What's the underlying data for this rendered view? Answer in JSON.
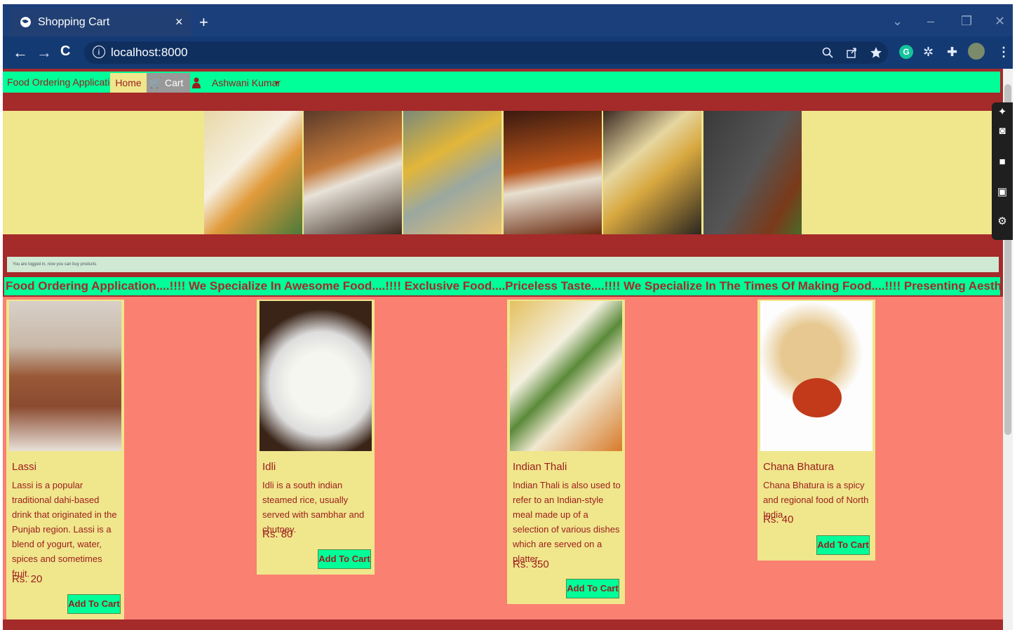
{
  "browser": {
    "tab_title": "Shopping Cart",
    "tab_close": "×",
    "new_tab": "+",
    "url": "localhost:8000",
    "window_controls": [
      "⌄",
      "–",
      "❐",
      "✕"
    ],
    "nav": {
      "back": "←",
      "forward": "→",
      "reload": "C"
    },
    "toolbar_icons": [
      "zoom-icon",
      "share-icon",
      "bookmark-star-icon",
      "grammarly-icon",
      "extension-icon",
      "puzzle-icon",
      "profile-avatar",
      "menu-icon"
    ]
  },
  "navbar": {
    "brand": "Food Ordering Application",
    "home": "Home",
    "cart": "Cart",
    "user": "Ashwani Kumar"
  },
  "alert": {
    "text": "You are logged in, now you can buy products"
  },
  "marquee": {
    "text": "Food Ordering Application....!!!! We Specialize In Awesome Food....!!!! Exclusive Food....Priceless Taste....!!!! We Specialize In The Times Of Making Food....!!!! Presenting Aesthetic Food....!!!! Count Memo"
  },
  "products": [
    {
      "name": "Lassi",
      "desc": "Lassi is a popular traditional dahi-based drink that originated in the Punjab region. Lassi is a blend of yogurt, water, spices and sometimes fruit.",
      "price": "Rs. 20",
      "button": "Add To Cart"
    },
    {
      "name": "Idli",
      "desc": "Idli is a south indian steamed rice, usually served with sambhar and chutney.",
      "price": "Rs. 80",
      "button": "Add To Cart"
    },
    {
      "name": "Indian Thali",
      "desc": "Indian Thali is also used to refer to an Indian-style meal made up of a selection of various dishes which are served on a platter.",
      "price": "Rs. 350",
      "button": "Add To Cart"
    },
    {
      "name": "Chana Bhatura",
      "desc": "Chana Bhatura is a spicy and regional food of North India",
      "price": "Rs. 40",
      "button": "Add To Cart"
    }
  ],
  "colors": {
    "page_bg": "#a52a2a",
    "nav_bg": "#00ff99",
    "banner_bg": "#f0e68c",
    "products_bg": "#fa8072",
    "text": "#9b1c1c"
  }
}
